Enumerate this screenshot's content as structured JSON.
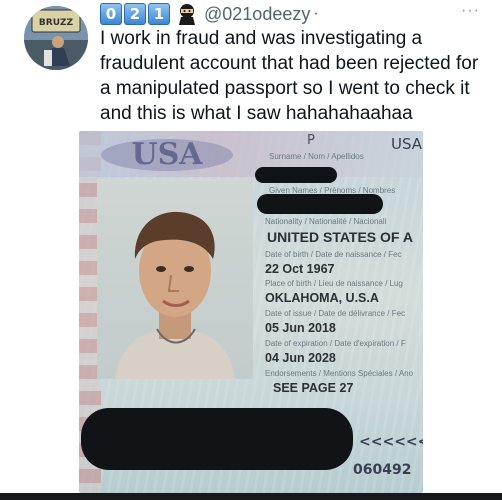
{
  "tweet": {
    "badges": [
      "0",
      "2",
      "1"
    ],
    "handle": "@021odeezy",
    "separator": "·",
    "more": "···",
    "text": "I work in fraud and was investigating a\nfraudulent account that had been rejected for\na manipulated passport so I went to check it\nand this is what I saw hahahahaahaa",
    "avatar_sign": "BRUZZ"
  },
  "passport": {
    "type": "P",
    "country": "USA",
    "emblem": "USA",
    "surname_label": "Surname / Nom / Apellidos",
    "given_names_label": "Given Names / Prénoms / Nombres",
    "nationality_label": "Nationality / Nationalité / Nacionali",
    "nationality": "UNITED STATES OF A",
    "dob_label": "Date of birth / Date de naissance / Fec",
    "dob": "22 Oct 1967",
    "pob_label": "Place of birth / Lieu de naissance / Lug",
    "pob": "OKLAHOMA, U.S.A",
    "issue_label": "Date of issue / Date de délivrance / Fec",
    "issue_date": "05 Jun 2018",
    "expiry_label": "Date of expiration / Date d'expiration / F",
    "expiry_date": "04 Jun 2028",
    "endorsements_label": "Endorsements / Mentions Spéciales / Ano",
    "endorsements": "SEE PAGE 27",
    "mrz_line1": "<<<<<<",
    "mrz_line2": "060492"
  }
}
